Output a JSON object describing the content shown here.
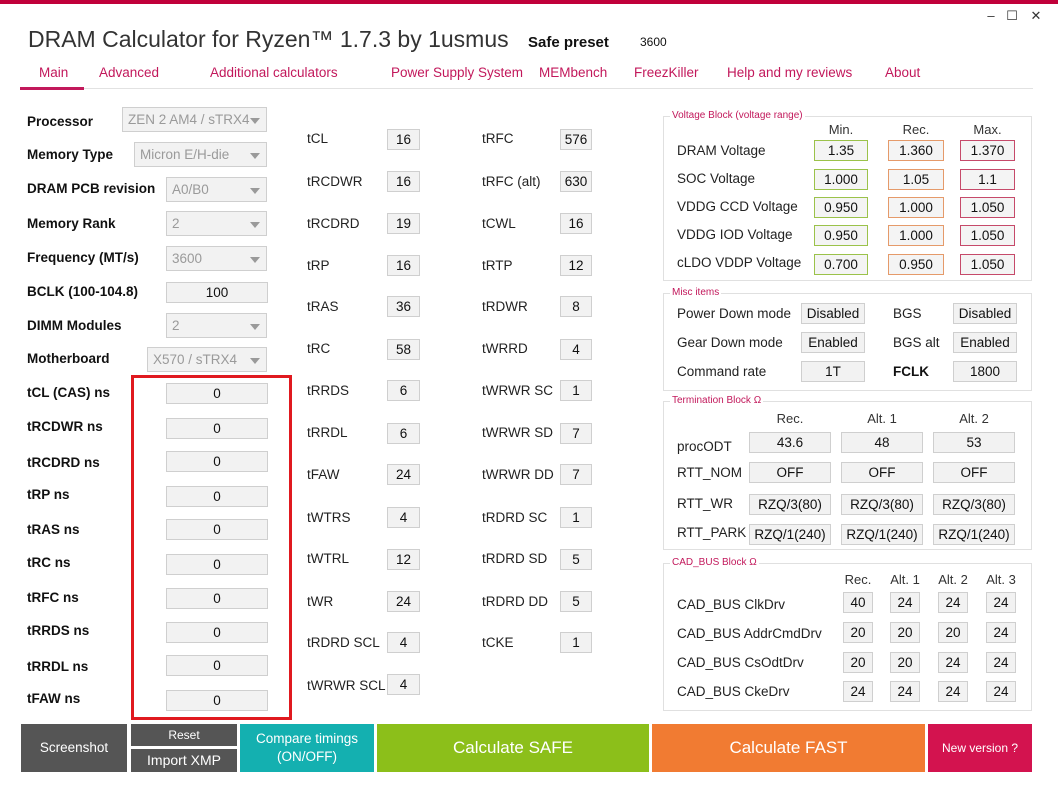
{
  "window": {
    "title": "DRAM Calculator for Ryzen™ 1.7.3 by 1usmus",
    "minimize": "–",
    "maximize": "☐",
    "close": "✕"
  },
  "preset": {
    "label": "Safe preset",
    "value": "3600"
  },
  "menu": [
    "Main",
    "Advanced",
    "Additional calculators",
    "Power Supply System",
    "MEMbench",
    "FreezKiller",
    "Help and my reviews",
    "About"
  ],
  "settings": {
    "processor": {
      "label": "Processor",
      "value": "ZEN 2 AM4 / sTRX4"
    },
    "memory_type": {
      "label": "Memory Type",
      "value": "Micron E/H-die"
    },
    "pcb_revision": {
      "label": "DRAM PCB revision",
      "value": "A0/B0"
    },
    "memory_rank": {
      "label": "Memory Rank",
      "value": "2"
    },
    "frequency": {
      "label": "Frequency (MT/s)",
      "value": "3600"
    },
    "bclk": {
      "label": "BCLK (100-104.8)",
      "value": "100"
    },
    "dimm_modules": {
      "label": "DIMM Modules",
      "value": "2"
    },
    "motherboard": {
      "label": "Motherboard",
      "value": "X570 / sTRX4"
    }
  },
  "ns_inputs": [
    {
      "label": "tCL (CAS) ns",
      "value": "0"
    },
    {
      "label": "tRCDWR ns",
      "value": "0"
    },
    {
      "label": "tRCDRD ns",
      "value": "0"
    },
    {
      "label": "tRP ns",
      "value": "0"
    },
    {
      "label": "tRAS ns",
      "value": "0"
    },
    {
      "label": "tRC ns",
      "value": "0"
    },
    {
      "label": "tRFC ns",
      "value": "0"
    },
    {
      "label": "tRRDS ns",
      "value": "0"
    },
    {
      "label": "tRRDL ns",
      "value": "0"
    },
    {
      "label": "tFAW ns",
      "value": "0"
    }
  ],
  "timings_left": [
    {
      "name": "tCL",
      "value": "16"
    },
    {
      "name": "tRCDWR",
      "value": "16"
    },
    {
      "name": "tRCDRD",
      "value": "19"
    },
    {
      "name": "tRP",
      "value": "16"
    },
    {
      "name": "tRAS",
      "value": "36"
    },
    {
      "name": "tRC",
      "value": "58"
    },
    {
      "name": "tRRDS",
      "value": "6"
    },
    {
      "name": "tRRDL",
      "value": "6"
    },
    {
      "name": "tFAW",
      "value": "24"
    },
    {
      "name": "tWTRS",
      "value": "4"
    },
    {
      "name": "tWTRL",
      "value": "12"
    },
    {
      "name": "tWR",
      "value": "24"
    },
    {
      "name": "tRDRD SCL",
      "value": "4"
    },
    {
      "name": "tWRWR SCL",
      "value": "4"
    }
  ],
  "timings_right": [
    {
      "name": "tRFC",
      "value": "576"
    },
    {
      "name": "tRFC (alt)",
      "value": "630"
    },
    {
      "name": "tCWL",
      "value": "16"
    },
    {
      "name": "tRTP",
      "value": "12"
    },
    {
      "name": "tRDWR",
      "value": "8"
    },
    {
      "name": "tWRRD",
      "value": "4"
    },
    {
      "name": "tWRWR SC",
      "value": "1"
    },
    {
      "name": "tWRWR SD",
      "value": "7"
    },
    {
      "name": "tWRWR DD",
      "value": "7"
    },
    {
      "name": "tRDRD SC",
      "value": "1"
    },
    {
      "name": "tRDRD SD",
      "value": "5"
    },
    {
      "name": "tRDRD DD",
      "value": "5"
    },
    {
      "name": "tCKE",
      "value": "1"
    }
  ],
  "voltage_block": {
    "title": "Voltage Block (voltage range)",
    "headers": [
      "Min.",
      "Rec.",
      "Max."
    ],
    "rows": [
      {
        "name": "DRAM Voltage",
        "min": "1.35",
        "rec": "1.360",
        "max": "1.370"
      },
      {
        "name": "SOC Voltage",
        "min": "1.000",
        "rec": "1.05",
        "max": "1.1"
      },
      {
        "name": "VDDG  CCD Voltage",
        "min": "0.950",
        "rec": "1.000",
        "max": "1.050"
      },
      {
        "name": "VDDG  IOD Voltage",
        "min": "0.950",
        "rec": "1.000",
        "max": "1.050"
      },
      {
        "name": "cLDO VDDP Voltage",
        "min": "0.700",
        "rec": "0.950",
        "max": "1.050"
      }
    ]
  },
  "misc_block": {
    "title": "Misc items",
    "power_down": {
      "label": "Power Down mode",
      "value": "Disabled"
    },
    "bgs": {
      "label": "BGS",
      "value": "Disabled"
    },
    "gear_down": {
      "label": "Gear Down mode",
      "value": "Enabled"
    },
    "bgs_alt": {
      "label": "BGS alt",
      "value": "Enabled"
    },
    "command_rate": {
      "label": "Command rate",
      "value": "1T"
    },
    "fclk": {
      "label": "FCLK",
      "value": "1800"
    }
  },
  "termination_block": {
    "title": "Termination Block Ω",
    "headers": [
      "Rec.",
      "Alt. 1",
      "Alt. 2"
    ],
    "rows": [
      {
        "name": "procODT",
        "values": [
          "43.6",
          "48",
          "53"
        ]
      },
      {
        "name": "RTT_NOM",
        "values": [
          "OFF",
          "OFF",
          "OFF"
        ]
      },
      {
        "name": "RTT_WR",
        "values": [
          "RZQ/3(80)",
          "RZQ/3(80)",
          "RZQ/3(80)"
        ]
      },
      {
        "name": "RTT_PARK",
        "values": [
          "RZQ/1(240)",
          "RZQ/1(240)",
          "RZQ/1(240)"
        ]
      }
    ]
  },
  "cad_block": {
    "title": "CAD_BUS Block Ω",
    "headers": [
      "Rec.",
      "Alt. 1",
      "Alt. 2",
      "Alt. 3"
    ],
    "rows": [
      {
        "name": "CAD_BUS ClkDrv",
        "values": [
          "40",
          "24",
          "24",
          "24"
        ]
      },
      {
        "name": "CAD_BUS AddrCmdDrv",
        "values": [
          "20",
          "20",
          "20",
          "24"
        ]
      },
      {
        "name": "CAD_BUS CsOdtDrv",
        "values": [
          "20",
          "20",
          "24",
          "24"
        ]
      },
      {
        "name": "CAD_BUS CkeDrv",
        "values": [
          "24",
          "24",
          "24",
          "24"
        ]
      }
    ]
  },
  "buttons": {
    "screenshot": "Screenshot",
    "reset": "Reset",
    "import_xmp": "Import XMP",
    "compare_line1": "Compare timings",
    "compare_line2": "(ON/OFF)",
    "calc_safe": "Calculate SAFE",
    "calc_fast": "Calculate FAST",
    "new_version": "New version ?"
  },
  "colors": {
    "accent": "#c2185b",
    "screenshot": "#555555",
    "compare": "#14b0b0",
    "safe": "#8cbf1a",
    "fast": "#f17b32",
    "new_version": "#d3134f",
    "highlight_frame": "#e0191f"
  }
}
